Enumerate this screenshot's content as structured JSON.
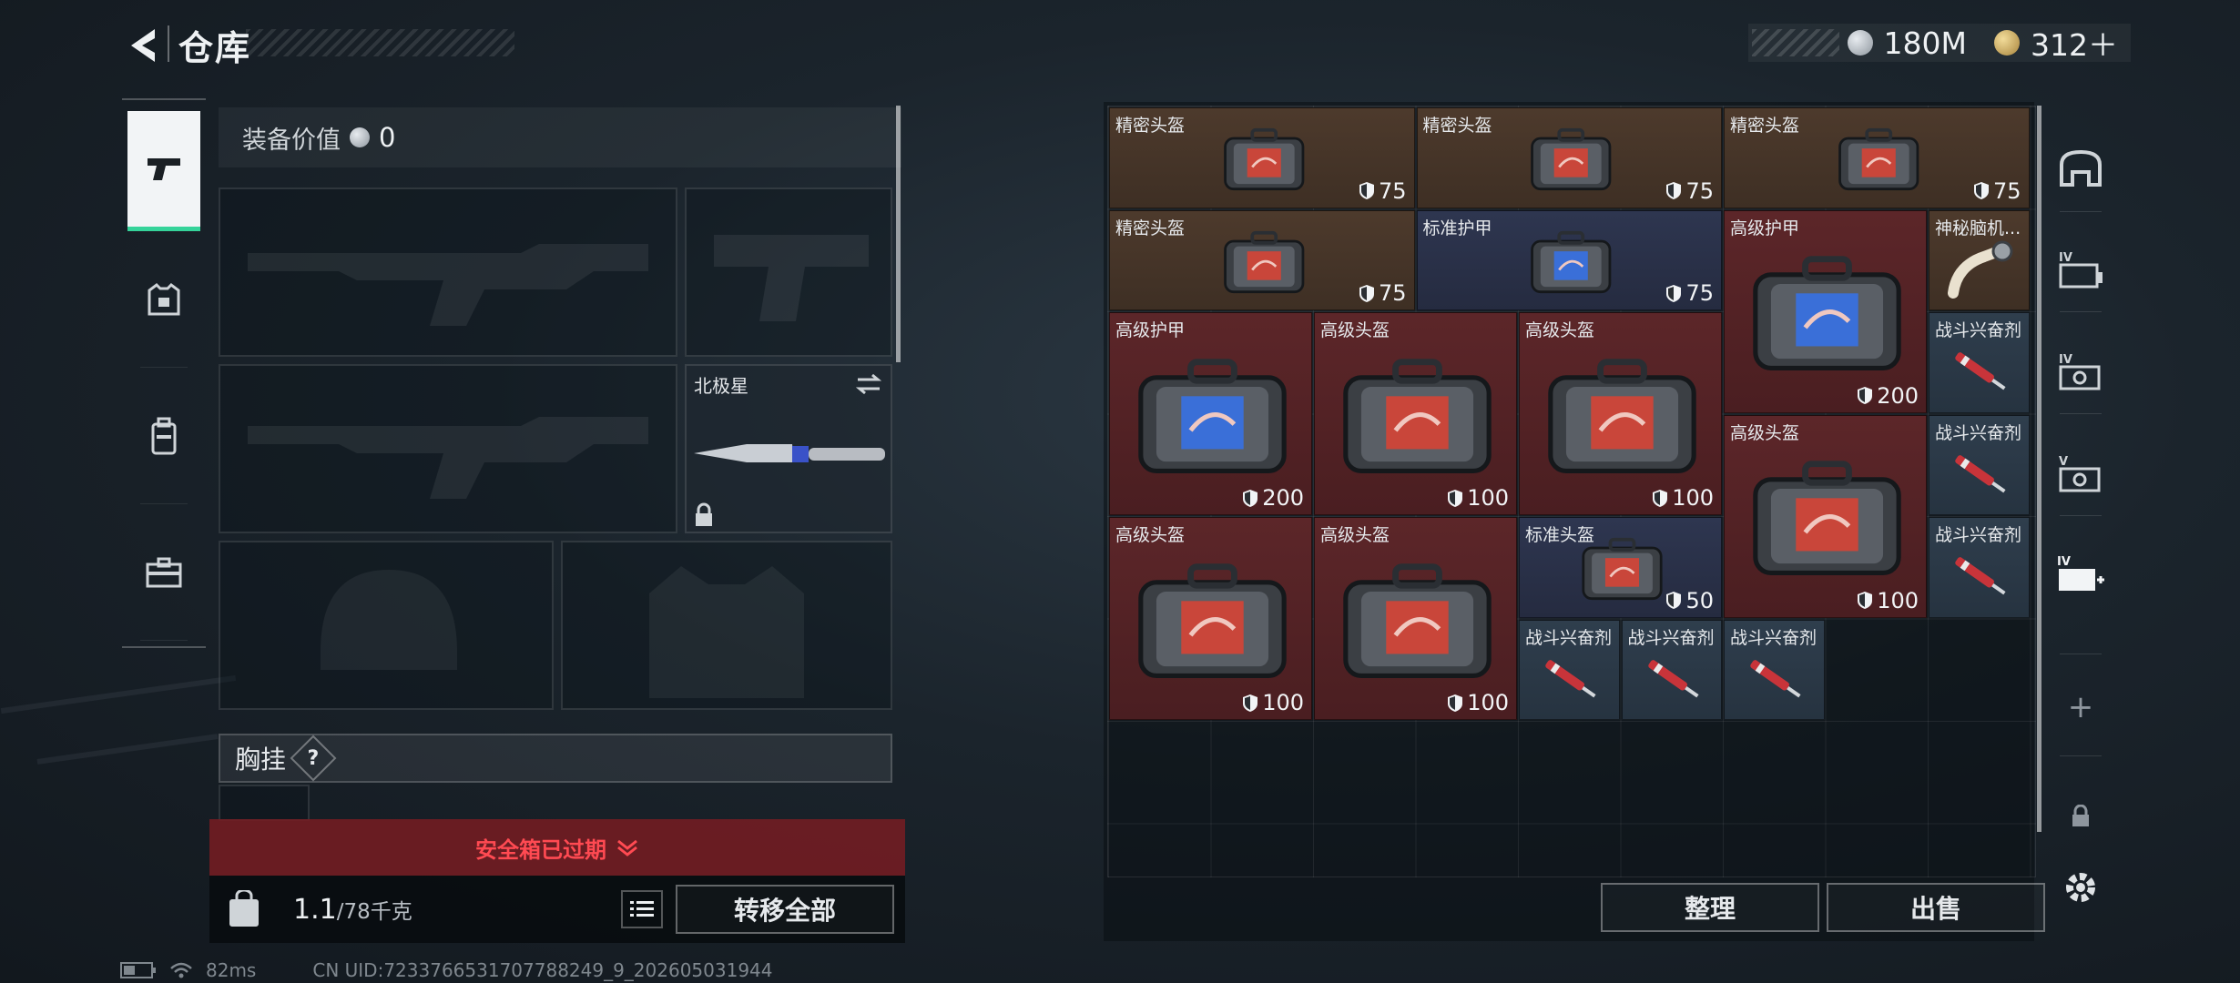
{
  "header": {
    "title": "仓库"
  },
  "currency": [
    {
      "icon": "silver-coin-icon",
      "value": "180M"
    },
    {
      "icon": "gold-coin-icon",
      "value": "312＋"
    }
  ],
  "side_tabs": [
    {
      "icon": "pistol-icon",
      "active": true
    },
    {
      "icon": "armor-vest-icon",
      "active": false
    },
    {
      "icon": "backpack-icon",
      "active": false
    },
    {
      "icon": "briefcase-icon",
      "active": false
    }
  ],
  "equipment": {
    "value_label": "装备价值",
    "value": "0",
    "melee_slot": {
      "name": "北极星"
    },
    "chest_rig_label": "胸挂",
    "chest_rig_help": "?",
    "safebox_status": "安全箱已过期",
    "weight": "1.1",
    "weight_capacity": "/78千克",
    "transfer_all": "转移全部"
  },
  "inventory": {
    "items": [
      {
        "name": "精密头盔",
        "durability": "75",
        "color": "brown"
      },
      {
        "name": "精密头盔",
        "durability": "75",
        "color": "brown"
      },
      {
        "name": "精密头盔",
        "durability": "75",
        "color": "brown"
      },
      {
        "name": "精密头盔",
        "durability": "75",
        "color": "brown"
      },
      {
        "name": "标准护甲",
        "durability": "75",
        "color": "navy"
      },
      {
        "name": "高级护甲",
        "durability": "200",
        "color": "red"
      },
      {
        "name": "神秘脑机...",
        "durability": "",
        "color": "brown"
      },
      {
        "name": "高级护甲",
        "durability": "200",
        "color": "red"
      },
      {
        "name": "高级头盔",
        "durability": "100",
        "color": "red"
      },
      {
        "name": "高级头盔",
        "durability": "100",
        "color": "red"
      },
      {
        "name": "战斗兴奋剂",
        "durability": "",
        "color": "slate"
      },
      {
        "name": "高级头盔",
        "durability": "100",
        "color": "red"
      },
      {
        "name": "战斗兴奋剂",
        "durability": "",
        "color": "slate"
      },
      {
        "name": "高级头盔",
        "durability": "100",
        "color": "red"
      },
      {
        "name": "高级头盔",
        "durability": "100",
        "color": "red"
      },
      {
        "name": "标准头盔",
        "durability": "50",
        "color": "navy"
      },
      {
        "name": "战斗兴奋剂",
        "durability": "",
        "color": "slate"
      },
      {
        "name": "战斗兴奋剂",
        "durability": "",
        "color": "slate"
      },
      {
        "name": "战斗兴奋剂",
        "durability": "",
        "color": "slate"
      },
      {
        "name": "战斗兴奋剂",
        "durability": "",
        "color": "slate"
      }
    ],
    "sort": "整理",
    "sell": "出售"
  },
  "right_tabs": [
    {
      "icon": "vault-icon"
    },
    {
      "icon": "ammo-crate-iv-icon",
      "label": "IV"
    },
    {
      "icon": "gear-case-iv-icon",
      "label": "IV"
    },
    {
      "icon": "gear-case-v-icon",
      "label": "V"
    },
    {
      "icon": "medkit-iv-icon",
      "label": "IV"
    },
    {
      "icon": "add-icon",
      "label": "+"
    },
    {
      "icon": "lock-icon"
    },
    {
      "icon": "settings-icon"
    }
  ],
  "status": {
    "ping": "82ms",
    "uid": "CN UID:7233766531707788249_9_202605031944"
  },
  "colors": {
    "accent_green": "#35d39a",
    "alert_red": "#ff4a52",
    "brown_item": "#4d3a2c",
    "red_item": "#5c2629",
    "navy_item": "#2e3650",
    "slate_item": "#2f3e4d"
  }
}
